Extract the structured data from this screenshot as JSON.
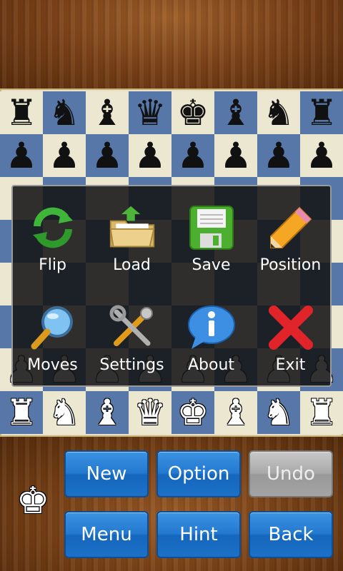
{
  "board": {
    "light_color": "#ece7d1",
    "dark_color": "#5677a8",
    "ranks": [
      [
        "♜",
        "♞",
        "♝",
        "♛",
        "♚",
        "♝",
        "♞",
        "♜"
      ],
      [
        "♟",
        "♟",
        "♟",
        "♟",
        "♟",
        "♟",
        "♟",
        "♟"
      ],
      [
        "",
        "",
        "",
        "",
        "",
        "",
        "",
        ""
      ],
      [
        "",
        "",
        "",
        "",
        "",
        "",
        "",
        ""
      ],
      [
        "",
        "",
        "",
        "",
        "",
        "",
        "",
        ""
      ],
      [
        "",
        "",
        "",
        "",
        "",
        "",
        "",
        ""
      ],
      [
        "♟",
        "♟",
        "♟",
        "♟",
        "♟",
        "♟",
        "♟",
        "♟"
      ],
      [
        "♜",
        "♞",
        "♝",
        "♛",
        "♚",
        "♝",
        "♞",
        "♜"
      ]
    ],
    "piece_colors": [
      "black",
      "black",
      "",
      "",
      "",
      "",
      "white",
      "white"
    ]
  },
  "menu": {
    "items": [
      {
        "label": "Flip",
        "icon": "flip-arrows-icon"
      },
      {
        "label": "Load",
        "icon": "folder-load-icon"
      },
      {
        "label": "Save",
        "icon": "floppy-disk-icon"
      },
      {
        "label": "Position",
        "icon": "pencil-icon"
      },
      {
        "label": "Moves",
        "icon": "magnifier-icon"
      },
      {
        "label": "Settings",
        "icon": "tools-icon"
      },
      {
        "label": "About",
        "icon": "info-bubble-icon"
      },
      {
        "label": "Exit",
        "icon": "red-x-icon"
      }
    ]
  },
  "turn_indicator": {
    "piece": "♚",
    "icon": "white-king-icon"
  },
  "buttons": {
    "new": "New",
    "option": "Option",
    "undo": "Undo",
    "menu": "Menu",
    "hint": "Hint",
    "back": "Back"
  },
  "colors": {
    "button_blue": "#2279cf",
    "button_disabled": "#a9a9a9"
  }
}
